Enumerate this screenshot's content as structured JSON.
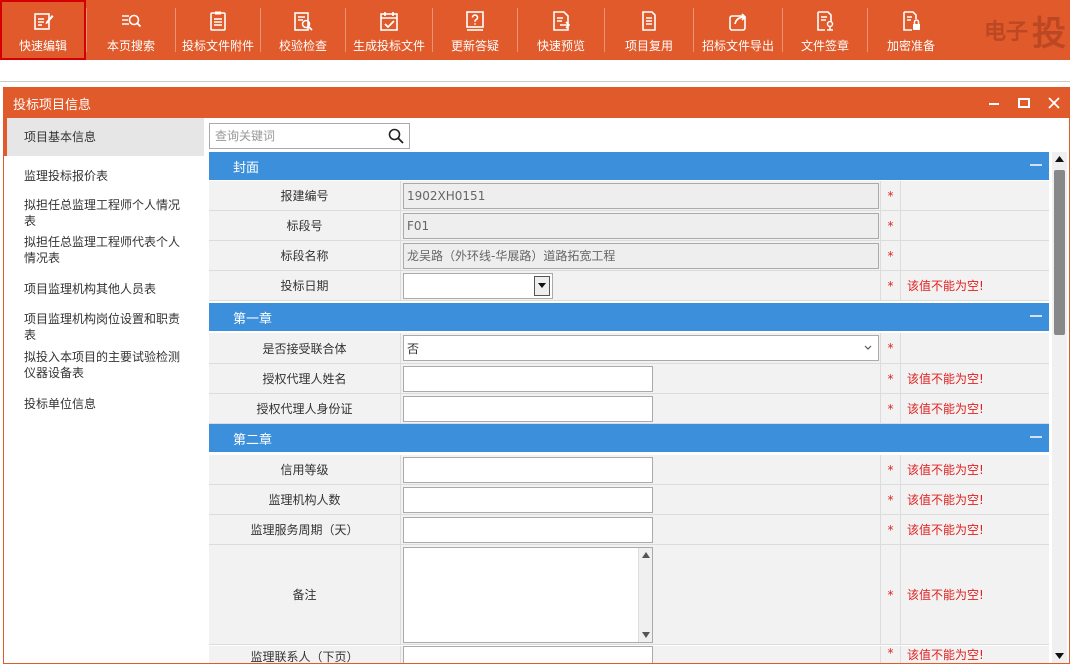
{
  "toolbar": {
    "buttons": [
      {
        "label": "快速编辑",
        "icon": "edit-icon"
      },
      {
        "label": "本页搜索",
        "icon": "search-list-icon"
      },
      {
        "label": "投标文件附件",
        "icon": "document-attachment-icon"
      },
      {
        "label": "校验检查",
        "icon": "check-document-icon"
      },
      {
        "label": "生成投标文件",
        "icon": "generate-file-icon"
      },
      {
        "label": "更新答疑",
        "icon": "question-icon"
      },
      {
        "label": "快速预览",
        "icon": "preview-icon"
      },
      {
        "label": "项目复用",
        "icon": "reuse-icon"
      },
      {
        "label": "招标文件导出",
        "icon": "export-icon"
      },
      {
        "label": "文件签章",
        "icon": "sign-icon"
      },
      {
        "label": "加密准备",
        "icon": "encrypt-icon"
      }
    ],
    "watermark_small": "电子",
    "watermark": "投"
  },
  "panel": {
    "title": "投标项目信息"
  },
  "sidebar": {
    "items": [
      {
        "label": "项目基本信息"
      },
      {
        "label": "监理投标报价表"
      },
      {
        "label": "拟担任总监理工程师个人情况表"
      },
      {
        "label": "拟担任总监理工程师代表个人情况表"
      },
      {
        "label": "项目监理机构其他人员表"
      },
      {
        "label": "项目监理机构岗位设置和职责表"
      },
      {
        "label": "拟投入本项目的主要试验检测仪器设备表"
      },
      {
        "label": "投标单位信息"
      }
    ]
  },
  "search": {
    "placeholder": "查询关键词"
  },
  "sections": {
    "cover": {
      "title": "封面"
    },
    "chapter1": {
      "title": "第一章"
    },
    "chapter2": {
      "title": "第二章"
    }
  },
  "fields": {
    "build_no": {
      "label": "报建编号",
      "value": "1902XH0151"
    },
    "lot_no": {
      "label": "标段号",
      "value": "F01"
    },
    "lot_name": {
      "label": "标段名称",
      "value": "龙吴路（外环线-华展路）道路拓宽工程"
    },
    "bid_date": {
      "label": "投标日期",
      "value": ""
    },
    "consortium": {
      "label": "是否接受联合体",
      "value": "否"
    },
    "agent_name": {
      "label": "授权代理人姓名",
      "value": ""
    },
    "agent_id": {
      "label": "授权代理人身份证",
      "value": ""
    },
    "credit": {
      "label": "信用等级",
      "value": ""
    },
    "staff_count": {
      "label": "监理机构人数",
      "value": ""
    },
    "service_period": {
      "label": "监理服务周期（天）",
      "value": ""
    },
    "remarks": {
      "label": "备注",
      "value": ""
    },
    "partial_next": {
      "label": "监理联系人（下页）"
    }
  },
  "messages": {
    "required": "*",
    "not_empty": "该值不能为空!"
  },
  "colors": {
    "brand": "#e05a2b",
    "section": "#3b8fdb",
    "error": "#e02020"
  }
}
